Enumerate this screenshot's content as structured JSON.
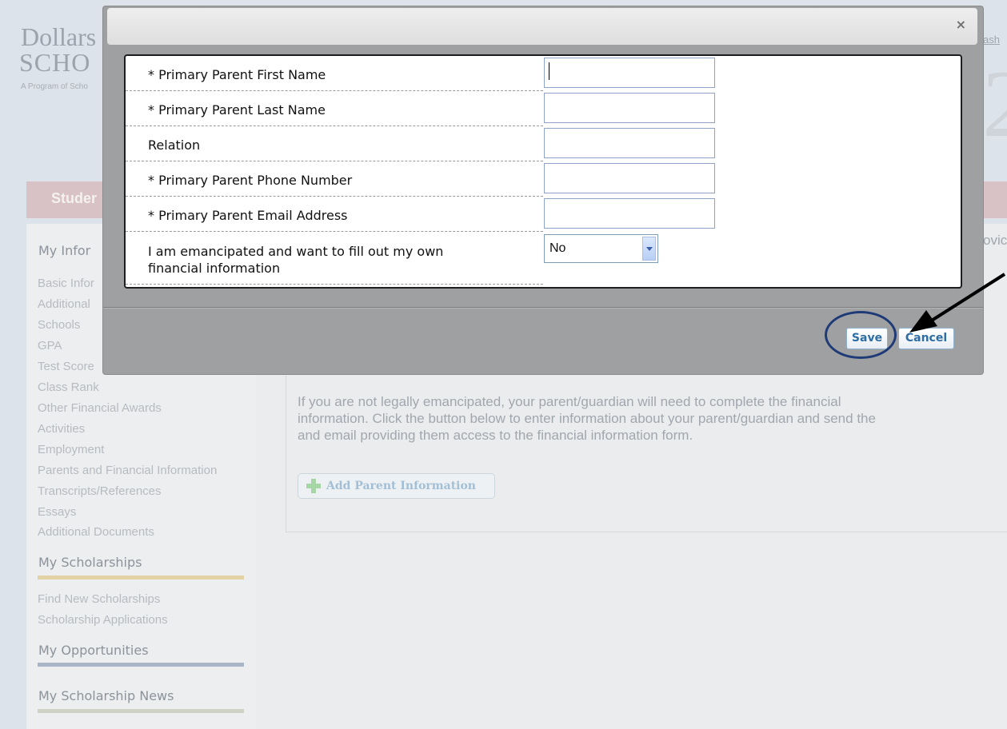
{
  "background": {
    "logo_line1": "Dollars",
    "logo_line2": "SCHO",
    "logo_tagline": "A Program of Scho",
    "top_right_fragment": "ash",
    "big_glyph": "2",
    "student_bar_text": "Studer",
    "right_fragment": "ovic",
    "sidebar": {
      "my_information": {
        "heading": "My Infor",
        "items": [
          "Basic Infor",
          "Additional",
          "Schools",
          "GPA",
          "Test Score",
          "Class Rank",
          "Other Financial Awards",
          "Activities",
          "Employment",
          "Parents and Financial Information",
          "Transcripts/References",
          "Essays",
          "Additional Documents"
        ]
      },
      "my_scholarships": {
        "heading": "My Scholarships",
        "color": "#e3d2a6",
        "items": [
          "Find New Scholarships",
          "Scholarship Applications"
        ]
      },
      "my_opportunities": {
        "heading": "My Opportunities",
        "color": "#a9b6c8"
      },
      "my_scholarship_news": {
        "heading": "My Scholarship News",
        "color": "#cfd1c5"
      }
    },
    "main": {
      "info_lines": [
        "If you are not legally emancipated, your parent/guardian will need to complete the financial",
        "information. Click the button below to enter information about your parent/guardian and send the",
        "and email providing them access to the financial information form."
      ],
      "add_parent_label": "Add Parent Information"
    }
  },
  "modal": {
    "close_glyph": "×",
    "fields": [
      {
        "label": "* Primary Parent First Name",
        "value": ""
      },
      {
        "label": "* Primary Parent Last Name",
        "value": ""
      },
      {
        "label": "Relation",
        "value": ""
      },
      {
        "label": "* Primary Parent Phone Number",
        "value": ""
      },
      {
        "label": "* Primary Parent Email Address",
        "value": ""
      }
    ],
    "emancipated": {
      "label_line1": "I am emancipated and want to fill out my own",
      "label_line2": "financial information",
      "selected": "No"
    },
    "save_label": "Save",
    "cancel_label": "Cancel"
  },
  "annotations": {
    "circle_color": "#1f3b77",
    "arrow_color": "#000000"
  }
}
